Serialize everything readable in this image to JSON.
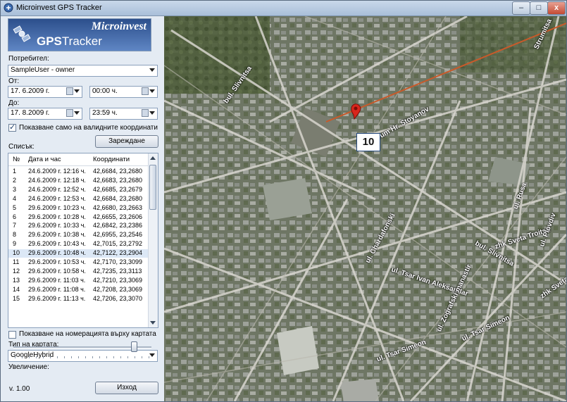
{
  "window": {
    "title": "Microinvest GPS Tracker",
    "minimize": "–",
    "maximize": "□",
    "close": "x"
  },
  "logo": {
    "brand": "Microinvest",
    "product_bold": "GPS",
    "product_thin": "Tracker"
  },
  "user": {
    "label": "Потребител:",
    "value": "SampleUser - owner"
  },
  "from": {
    "label": "От:",
    "date": "17.  6.2009 г.",
    "time": "00:00 ч."
  },
  "to": {
    "label": "До:",
    "date": "17.  8.2009 г.",
    "time": "23:59 ч."
  },
  "valid_only": {
    "label": "Показване само на валидните координати",
    "checked": true
  },
  "load_button": "Зареждане",
  "list": {
    "label": "Списък:",
    "headers": [
      "№",
      "Дата и час",
      "Координати"
    ],
    "rows": [
      {
        "n": "1",
        "dt": "24.6.2009 г. 12:16 ч.",
        "c": "42,6684, 23,2680"
      },
      {
        "n": "2",
        "dt": "24.6.2009 г. 12:18 ч.",
        "c": "42,6683, 23,2680"
      },
      {
        "n": "3",
        "dt": "24.6.2009 г. 12:52 ч.",
        "c": "42,6685, 23,2679"
      },
      {
        "n": "4",
        "dt": "24.6.2009 г. 12:53 ч.",
        "c": "42,6684, 23,2680"
      },
      {
        "n": "5",
        "dt": "29.6.2009 г. 10:23 ч.",
        "c": "42,6680, 23,2663"
      },
      {
        "n": "6",
        "dt": "29.6.2009 г. 10:28 ч.",
        "c": "42,6655, 23,2606"
      },
      {
        "n": "7",
        "dt": "29.6.2009 г. 10:33 ч.",
        "c": "42,6842, 23,2386"
      },
      {
        "n": "8",
        "dt": "29.6.2009 г. 10:38 ч.",
        "c": "42,6955, 23,2546"
      },
      {
        "n": "9",
        "dt": "29.6.2009 г. 10:43 ч.",
        "c": "42,7015, 23,2792"
      },
      {
        "n": "10",
        "dt": "29.6.2009 г. 10:48 ч.",
        "c": "42,7122, 23,2904"
      },
      {
        "n": "11",
        "dt": "29.6.2009 г. 10:53 ч.",
        "c": "42,7170, 23,3099"
      },
      {
        "n": "12",
        "dt": "29.6.2009 г. 10:58 ч.",
        "c": "42,7235, 23,3113"
      },
      {
        "n": "13",
        "dt": "29.6.2009 г. 11:03 ч.",
        "c": "42,7210, 23,3069"
      },
      {
        "n": "14",
        "dt": "29.6.2009 г. 11:08 ч.",
        "c": "42,7208, 23,3069"
      },
      {
        "n": "15",
        "dt": "29.6.2009 г. 11:13 ч.",
        "c": "42,7206, 23,3070"
      }
    ]
  },
  "show_numbers": {
    "label": "Показване на номерацията върху картата",
    "checked": false
  },
  "map_type": {
    "label": "Тип на картата:",
    "value": "GoogleHybrid"
  },
  "zoom": {
    "label": "Увеличение:",
    "level_fraction": 0.9
  },
  "version": "v. 1.00",
  "exit_button": "Изход",
  "map": {
    "marker_number": "10",
    "street_labels": [
      "bul. Slivnitsa",
      "ul. Krum Hr. Stoyanov",
      "zhk Sveta Troitsa",
      "bul. Slivnitsa",
      "zhk Sveta Troitsa",
      "ul. Chardafonski",
      "ul. Tsar Ivan Aleksandar",
      "ul. Zografski manastir",
      "ul. Tsar Simeon",
      "ul. Rusa",
      "ul. Plovdiv",
      "Strumitsa",
      "ul. Tsar Simeon"
    ]
  }
}
